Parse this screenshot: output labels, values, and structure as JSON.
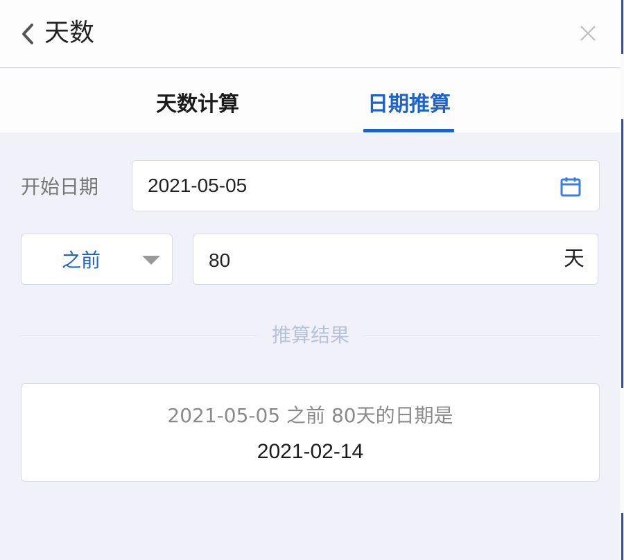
{
  "header": {
    "title": "天数",
    "back_icon": "chevron-left-icon",
    "close_icon": "close-icon"
  },
  "tabs": [
    {
      "label": "天数计算",
      "active": false
    },
    {
      "label": "日期推算",
      "active": true
    }
  ],
  "form": {
    "start_date_label": "开始日期",
    "start_date_value": "2021-05-05",
    "calendar_icon": "calendar-icon",
    "direction_value": "之前",
    "days_value": "80",
    "days_unit": "天"
  },
  "result": {
    "section_label": "推算结果",
    "description": "2021-05-05 之前 80天的日期是",
    "value": "2021-02-14"
  },
  "colors": {
    "accent": "#1e63cc",
    "background": "#f1f2f9",
    "panel": "#fdfdfe"
  }
}
